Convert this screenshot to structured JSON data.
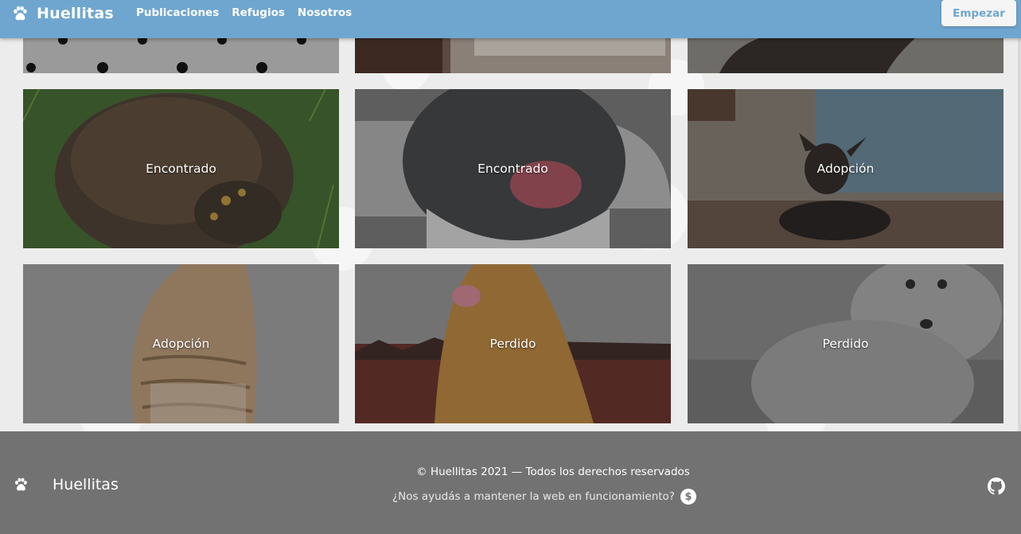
{
  "header": {
    "brand": "Huellitas",
    "nav": [
      {
        "label": "Publicaciones"
      },
      {
        "label": "Refugios"
      },
      {
        "label": "Nosotros"
      }
    ],
    "cta": "Empezar"
  },
  "posts": [
    {
      "status": "Encontrado",
      "photo": "turtle"
    },
    {
      "status": "Encontrado",
      "photo": "pitbull"
    },
    {
      "status": "Adopción",
      "photo": "chihuahua"
    },
    {
      "status": "Adopción",
      "photo": "cat"
    },
    {
      "status": "Perdido",
      "photo": "golden-retriever"
    },
    {
      "status": "Perdido",
      "photo": "poodle"
    }
  ],
  "footer": {
    "brand": "Huellitas",
    "copyright": "© Huellitas 2021 — Todos los derechos reservados",
    "support": "¿Nos ayudás a mantener la web en funcionamiento?",
    "donate_symbol": "$"
  },
  "colors": {
    "navbar": "#6fa6cf",
    "footer": "#727272",
    "background": "#ececec"
  },
  "icons": [
    "paw-icon",
    "dollar-icon",
    "github-icon"
  ]
}
